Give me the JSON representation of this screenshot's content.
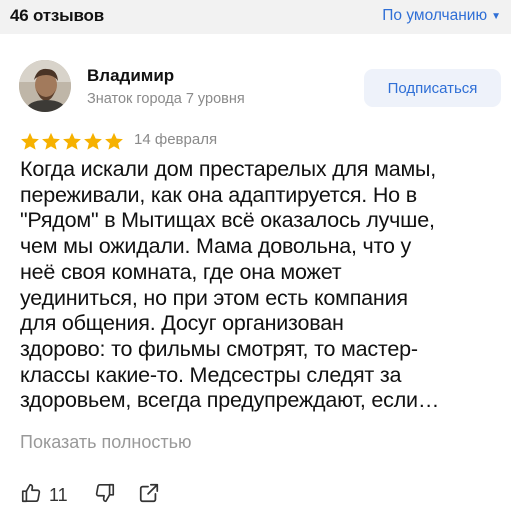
{
  "header": {
    "reviews_count": "46 отзывов",
    "sort_label": "По умолчанию",
    "sort_icon": "caret-down-icon"
  },
  "review": {
    "author": {
      "name": "Владимир",
      "status": "Знаток города 7 уровня"
    },
    "subscribe_label": "Подписаться",
    "rating": 5,
    "rating_color": "#f6b100",
    "date": "14 февраля",
    "text_lines": [
      "Когда искали дом престарелых для мамы,",
      "переживали, как она адаптируется. Но в",
      "\"Рядом\" в Мытищах всё оказалось лучше,",
      "чем мы ожидали. Мама довольна, что у",
      "неё своя комната, где она может",
      "уединиться, но при этом есть компания",
      "для общения. Досуг организован",
      "здорово: то фильмы смотрят, то мастер-",
      "классы какие-то. Медсестры следят за",
      "здоровьем, всегда предупреждают, если…"
    ],
    "show_more_label": "Показать полностью",
    "likes_count": "11"
  },
  "colors": {
    "accent": "#2f6fd6",
    "muted_text": "#8a8a8a",
    "topbar_bg": "#f2f2f2",
    "button_bg": "#eef2fa"
  }
}
